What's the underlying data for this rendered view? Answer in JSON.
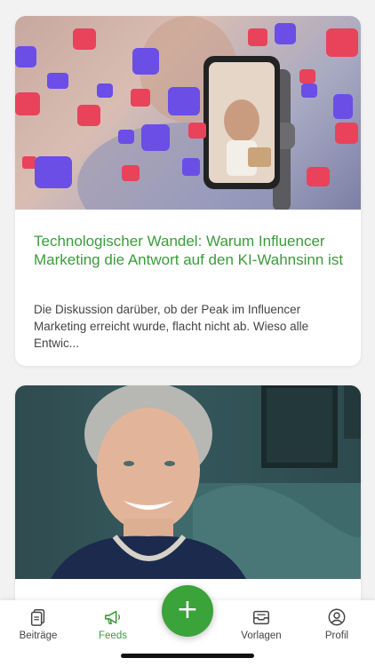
{
  "feed": {
    "posts": [
      {
        "title": "Technologischer Wandel: Warum Influencer Marketing die Antwort auf den KI-Wahnsinn ist",
        "excerpt": "Die Diskussion darüber, ob der Peak im Influencer Marketing erreicht wurde, flacht nicht ab. Wieso alle Entwic...",
        "image_icon": "influencer-smartphone-photo"
      },
      {
        "title": "",
        "excerpt": "",
        "image_icon": "portrait-photo"
      }
    ]
  },
  "tabbar": {
    "tabs": [
      {
        "label": "Beiträge",
        "icon": "documents-icon"
      },
      {
        "label": "Feeds",
        "icon": "megaphone-icon",
        "active": true
      },
      {
        "label": "Vorlagen",
        "icon": "inbox-tray-icon"
      },
      {
        "label": "Profil",
        "icon": "user-circle-icon"
      }
    ],
    "fab_symbol": "+"
  },
  "colors": {
    "accent": "#3a9c3a",
    "fab": "#3aa33a",
    "background": "#f2f2f2"
  }
}
